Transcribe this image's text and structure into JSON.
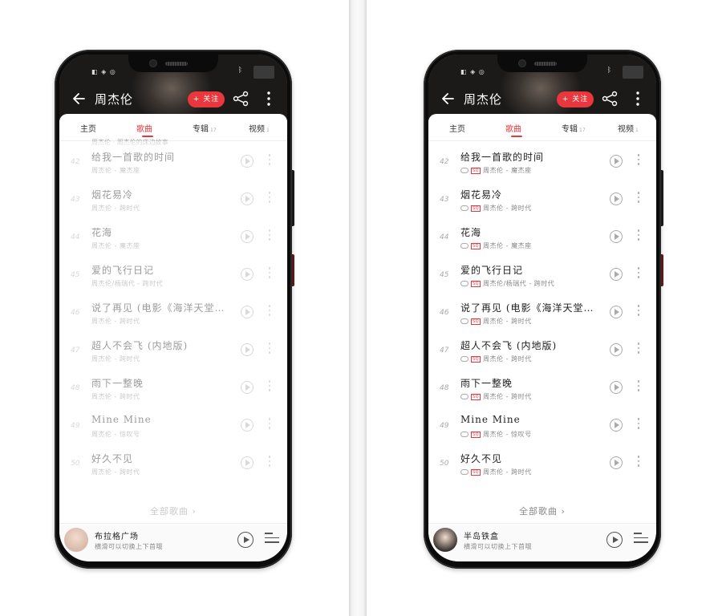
{
  "screens": [
    {
      "id": "left",
      "dimmed": true,
      "status_left": "◧ ◈ ◎",
      "artist_name": "周杰伦",
      "follow_label": "+ 关注",
      "tabs": [
        {
          "label": "主页",
          "sup": ""
        },
        {
          "label": "歌曲",
          "sup": ""
        },
        {
          "label": "专辑",
          "sup": "17"
        },
        {
          "label": "视频",
          "sup": "1"
        }
      ],
      "active_tab_index": 1,
      "partial_row_text": "周杰伦 · 周杰伦的床边故事",
      "show_quality_badges": false,
      "songs": [
        {
          "idx": "42",
          "title": "给我一首歌的时间",
          "sub": "周杰伦 - 魔杰座"
        },
        {
          "idx": "43",
          "title": "烟花易冷",
          "sub": "周杰伦 - 跨时代"
        },
        {
          "idx": "44",
          "title": "花海",
          "sub": "周杰伦 - 魔杰座"
        },
        {
          "idx": "45",
          "title": "爱的飞行日记",
          "sub": "周杰伦/杨瑞代 - 跨时代"
        },
        {
          "idx": "46",
          "title": "说了再见 (电影《海洋天堂…",
          "sub": "周杰伦 - 跨时代"
        },
        {
          "idx": "47",
          "title": "超人不会飞 (内地版)",
          "sub": "周杰伦 - 跨时代"
        },
        {
          "idx": "48",
          "title": "雨下一整晚",
          "sub": "周杰伦 - 跨时代"
        },
        {
          "idx": "49",
          "title": "Mine Mine",
          "sub": "周杰伦 - 惊叹号"
        },
        {
          "idx": "50",
          "title": "好久不见",
          "sub": "周杰伦 - 跨时代"
        }
      ],
      "all_songs_label": "全部歌曲 ›",
      "player": {
        "title": "布拉格广场",
        "hint": "横滑可以切换上下首哦",
        "cover_color": "#d8b8a8"
      }
    },
    {
      "id": "right",
      "dimmed": false,
      "status_left": "◧ ◈ ◎",
      "artist_name": "周杰伦",
      "follow_label": "+ 关注",
      "tabs": [
        {
          "label": "主页",
          "sup": ""
        },
        {
          "label": "歌曲",
          "sup": ""
        },
        {
          "label": "专辑",
          "sup": "17"
        },
        {
          "label": "视频",
          "sup": "1"
        }
      ],
      "active_tab_index": 1,
      "partial_row_text": "",
      "show_quality_badges": true,
      "quality_badge": "SQ",
      "songs": [
        {
          "idx": "42",
          "title": "给我一首歌的时间",
          "sub": "周杰伦 - 魔杰座"
        },
        {
          "idx": "43",
          "title": "烟花易冷",
          "sub": "周杰伦 - 跨时代"
        },
        {
          "idx": "44",
          "title": "花海",
          "sub": "周杰伦 - 魔杰座"
        },
        {
          "idx": "45",
          "title": "爱的飞行日记",
          "sub": "周杰伦/杨瑞代 - 跨时代"
        },
        {
          "idx": "46",
          "title": "说了再见 (电影《海洋天堂…",
          "sub": "周杰伦 - 跨时代"
        },
        {
          "idx": "47",
          "title": "超人不会飞 (内地版)",
          "sub": "周杰伦 - 跨时代"
        },
        {
          "idx": "48",
          "title": "雨下一整晚",
          "sub": "周杰伦 - 跨时代"
        },
        {
          "idx": "49",
          "title": "Mine Mine",
          "sub": "周杰伦 - 惊叹号"
        },
        {
          "idx": "50",
          "title": "好久不见",
          "sub": "周杰伦 - 跨时代"
        }
      ],
      "all_songs_label": "全部歌曲 ›",
      "player": {
        "title": "半岛铁盒",
        "hint": "横滑可以切换上下首哦",
        "cover_color": "#3a3430"
      }
    }
  ],
  "colors": {
    "accent": "#e8383d",
    "text_primary": "#222222",
    "text_secondary": "#888888"
  }
}
